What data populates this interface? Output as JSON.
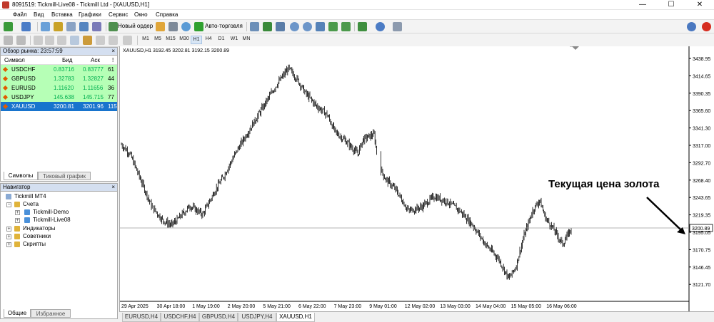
{
  "window": {
    "title": "8091519: Tickmill-Live08 - Tickmill Ltd - [XAUUSD,H1]",
    "min": "—",
    "max": "☐",
    "close": "✕"
  },
  "menu": [
    "Файл",
    "Вид",
    "Вставка",
    "Графики",
    "Сервис",
    "Окно",
    "Справка"
  ],
  "toolbar": {
    "new_order": "Новый ордер",
    "autotrading": "Авто-торговля",
    "timeframes": [
      "M1",
      "M5",
      "M15",
      "M30",
      "H1",
      "H4",
      "D1",
      "W1",
      "MN"
    ],
    "active_timeframe": "H1"
  },
  "market_watch": {
    "title": "Обзор рынка: 23:57:59",
    "col_symbol": "Символ",
    "col_bid": "Бид",
    "col_ask": "Аск",
    "col_spread": "!",
    "rows": [
      {
        "symbol": "USDCHF",
        "bid": "0.83716",
        "ask": "0.83777",
        "spread": "61"
      },
      {
        "symbol": "GBPUSD",
        "bid": "1.32783",
        "ask": "1.32827",
        "spread": "44"
      },
      {
        "symbol": "EURUSD",
        "bid": "1.11620",
        "ask": "1.11656",
        "spread": "36"
      },
      {
        "symbol": "USDJPY",
        "bid": "145.638",
        "ask": "145.715",
        "spread": "77"
      },
      {
        "symbol": "XAUUSD",
        "bid": "3200.81",
        "ask": "3201.96",
        "spread": "115"
      }
    ],
    "tabs": [
      "Символы",
      "Тиковый график"
    ]
  },
  "navigator": {
    "title": "Навигатор",
    "root": "Tickmill MT4",
    "accounts": "Счета",
    "account_list": [
      "Tickmill-Demo",
      "Tickmill-Live08"
    ],
    "indicators": "Индикаторы",
    "advisors": "Советники",
    "scripts": "Скрипты",
    "tabs": [
      "Общие",
      "Избранное"
    ]
  },
  "chart": {
    "info": "XAUUSD,H1  3192.45 3202.81 3192.15 3200.89",
    "annotation": "Текущая цена золота",
    "current_price": "3200.89",
    "price_labels": [
      "3438.95",
      "3414.65",
      "3390.35",
      "3365.60",
      "3341.30",
      "3317.00",
      "3292.70",
      "3268.40",
      "3243.65",
      "3219.35",
      "3195.05",
      "3170.75",
      "3146.45",
      "3121.70"
    ],
    "time_labels": [
      "29 Apr 2025",
      "30 Apr 18:00",
      "1 May 19:00",
      "2 May 20:00",
      "5 May 21:00",
      "6 May 22:00",
      "7 May 23:00",
      "9 May 01:00",
      "12 May 02:00",
      "13 May 03:00",
      "14 May 04:00",
      "15 May 05:00",
      "16 May 06:00"
    ],
    "tabs": [
      "EURUSD,H4",
      "USDCHF,H4",
      "GBPUSD,H4",
      "USDJPY,H4",
      "XAUUSD,H1"
    ],
    "active_tab": "XAUUSD,H1"
  },
  "colors": {
    "bid_up": "#00b050",
    "row_bg": "#b6ffb6",
    "row_selected": "#1874cd",
    "candle": "#000000"
  }
}
